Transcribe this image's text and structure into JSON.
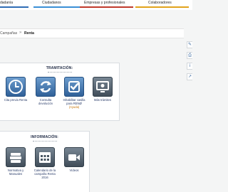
{
  "topnav": {
    "tabs": [
      {
        "label": "dadanía",
        "color": "#2f6db5"
      },
      {
        "label": "Ciudadanos",
        "color": "#3a8fd6"
      },
      {
        "label": "Empresas y profesionales",
        "color": "#c0392b"
      },
      {
        "label": "Colaboradores",
        "color": "#e1a21b"
      }
    ]
  },
  "breadcrumb": {
    "previous": "Campañas",
    "separator": "»",
    "current": "Renta"
  },
  "side_tools": [
    "edit-icon",
    "print-icon",
    "info-icon",
    "share-icon"
  ],
  "tramitacion": {
    "title": "TRAMITACIÓN:",
    "items": [
      {
        "label": "Cita previa Renta",
        "icon": "clock-icon"
      },
      {
        "label": "Consulta devolución",
        "icon": "refund-arrows-icon"
      },
      {
        "label": "Inhabilitar casilla para RENØ",
        "sub": "(Ayuda)",
        "icon": "checkbox-icon"
      },
      {
        "label": "Más trámites",
        "icon": "monitor-icon"
      }
    ]
  },
  "informacion": {
    "title": "INFORMACIÓN:",
    "items": [
      {
        "label": "Normativa y Manuales",
        "icon": "books-icon"
      },
      {
        "label": "Calendario de la campaña Renta 2016",
        "icon": "calendar-icon"
      },
      {
        "label": "Vídeos",
        "icon": "video-camera-icon"
      }
    ]
  }
}
